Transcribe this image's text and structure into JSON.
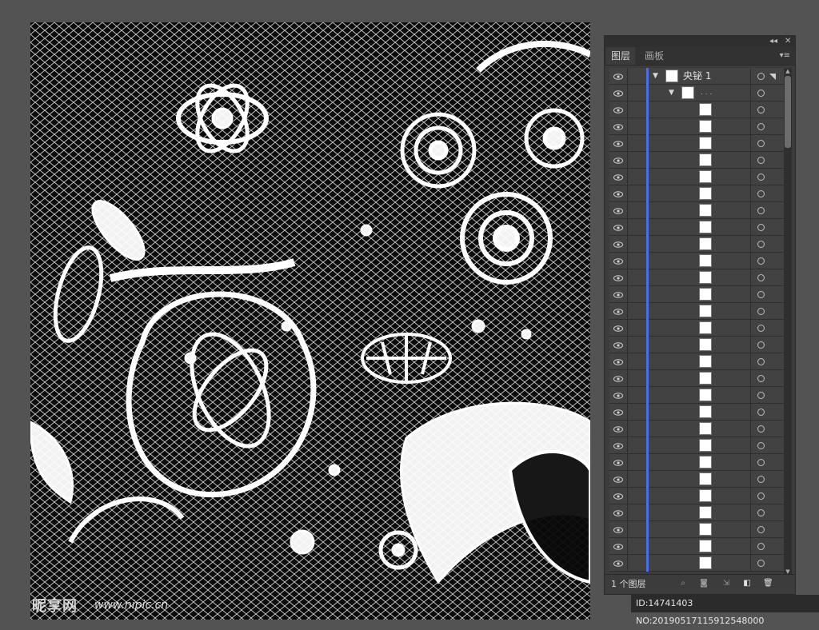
{
  "panel": {
    "tabs": [
      {
        "label": "图层",
        "active": true
      },
      {
        "label": "画板",
        "active": false
      }
    ],
    "top_layer": {
      "name": "央铋 1"
    },
    "sub_layer": {
      "name": ". . ."
    },
    "footer_label": "1 个图层"
  },
  "watermark": {
    "logo_text": "昵享网",
    "url": "www.nipic.cn",
    "id_text": "ID:14741403 NO:20190517115912548000"
  },
  "colors": {
    "canvas_bg": "#535353",
    "layer_color_bar": "#4e6fd6",
    "artwork_bg": "#0b0b0b",
    "artwork_lace": "#ffffff"
  },
  "icons": {
    "visibility": "eye-icon",
    "expand": "triangle-down-icon",
    "target": "target-circle-icon",
    "footer": [
      "search-icon",
      "make-clipping-mask-icon",
      "create-sublayer-icon",
      "create-new-layer-icon",
      "delete-icon"
    ]
  }
}
